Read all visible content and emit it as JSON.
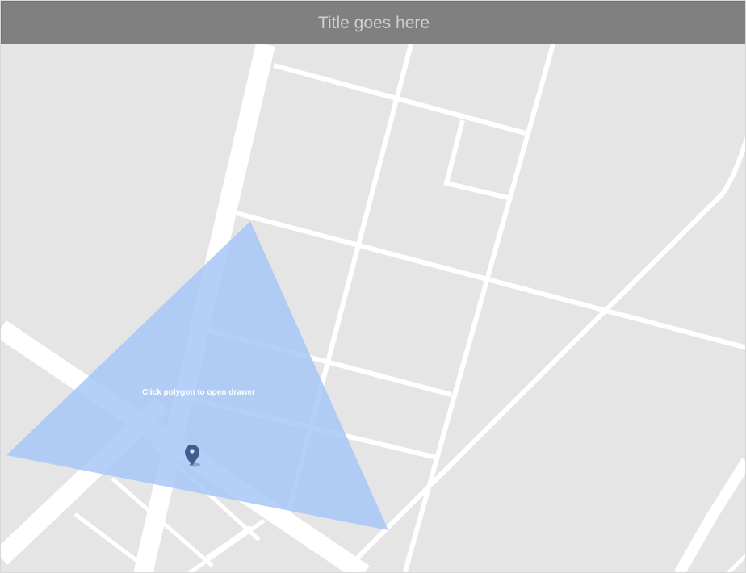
{
  "header": {
    "title": "Title goes here"
  },
  "map": {
    "polygon_label": "Click polygon to open drawer",
    "polygon_color": "#a4c6f7",
    "marker_color": "#3f5f8f",
    "background_color": "#e5e5e5",
    "road_color": "#ffffff",
    "marker_icon": "map-pin-icon"
  }
}
